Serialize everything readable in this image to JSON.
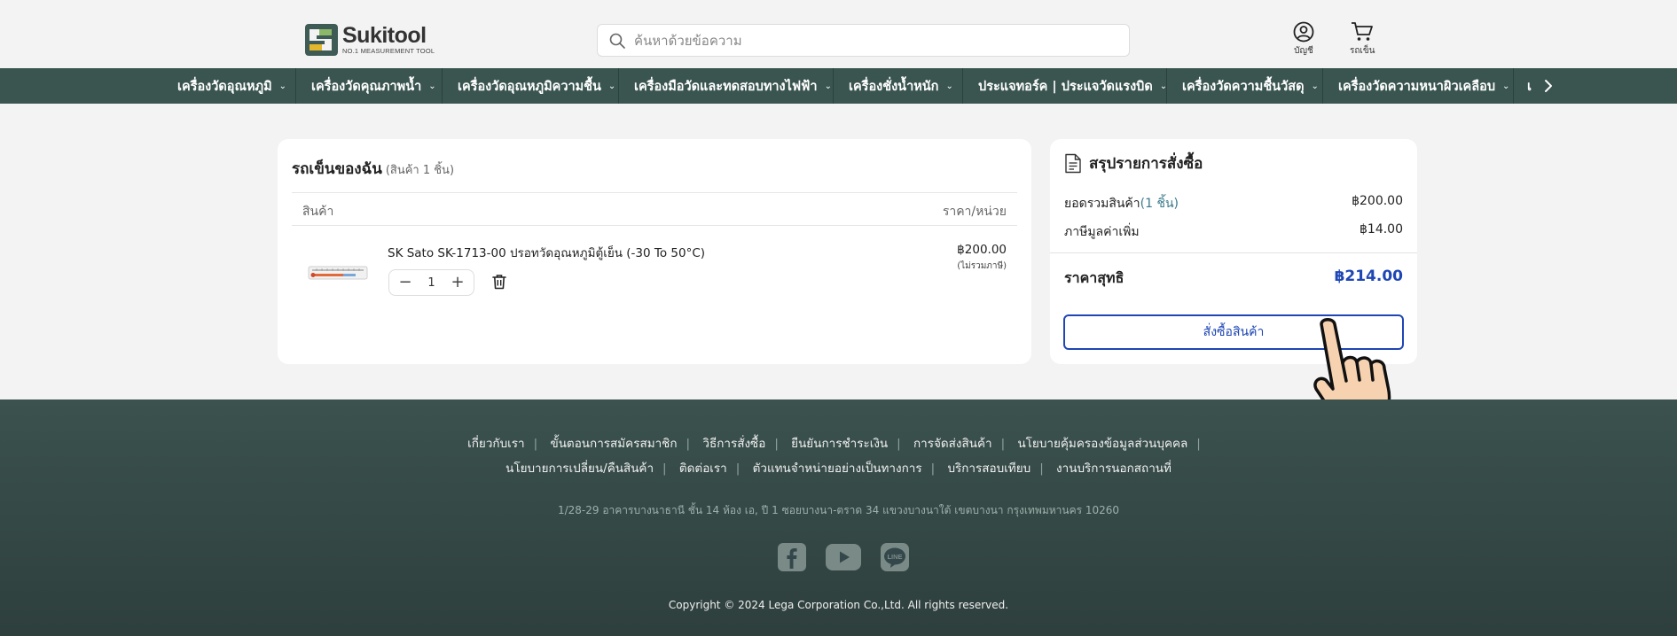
{
  "header": {
    "logo": {
      "name": "Sukitool",
      "tagline": "NO.1 MEASUREMENT TOOL"
    },
    "search": {
      "placeholder": "ค้นหาด้วยข้อความ"
    },
    "account_label": "บัญชี",
    "cart_label": "รถเข็น"
  },
  "nav": {
    "items": [
      "เครื่องวัดอุณหภูมิ",
      "เครื่องวัดคุณภาพน้ำ",
      "เครื่องวัดอุณหภูมิความชื้น",
      "เครื่องมือวัดและทดสอบทางไฟฟ้า",
      "เครื่องชั่งน้ำหนัก",
      "ประแจทอร์ค | ประแจวัดแรงบิด",
      "เครื่องวัดความชื้นวัสดุ",
      "เครื่องวัดความหนาผิวเคลือบ"
    ],
    "partial": "เ"
  },
  "cart": {
    "title": "รถเข็นของฉัน",
    "count_label": "(สินค้า 1 ชิ้น)",
    "col_product": "สินค้า",
    "col_price": "ราคา/หน่วย",
    "item": {
      "name": "SK Sato SK-1713-00 ปรอทวัดอุณหภูมิตู้เย็น (-30 To 50°C)",
      "quantity": "1",
      "price": "฿200.00",
      "price_note": "(ไม่รวมภาษี)"
    }
  },
  "summary": {
    "title": "สรุปรายการสั่งซื้อ",
    "subtotal_label": "ยอดรวมสินค้า",
    "subtotal_count": "(1 ชิ้น)",
    "subtotal": "฿200.00",
    "vat_label": "ภาษีมูลค่าเพิ่ม",
    "vat": "฿14.00",
    "total_label": "ราคาสุทธิ",
    "total": "฿214.00",
    "order_button": "สั่งซื้อสินค้า"
  },
  "footer": {
    "links_row1": [
      "เกี่ยวกับเรา",
      "ขั้นตอนการสมัครสมาชิก",
      "วิธีการสั่งซื้อ",
      "ยืนยันการชำระเงิน",
      "การจัดส่งสินค้า",
      "นโยบายคุ้มครองข้อมูลส่วนบุคคล"
    ],
    "links_row2": [
      "นโยบายการเปลี่ยน/คืนสินค้า",
      "ติดต่อเรา",
      "ตัวแทนจำหน่ายอย่างเป็นทางการ",
      "บริการสอบเทียบ",
      "งานบริการนอกสถานที่"
    ],
    "address": "1/28-29 อาคารบางนาธานี ชั้น 14 ห้อง เอ, ปี 1 ซอยบางนา-ตราด 34 แขวงบางนาใต้ เขตบางนา กรุงเทพมหานคร 10260",
    "socials": [
      "facebook-icon",
      "youtube-icon",
      "line-icon"
    ],
    "copyright": "Copyright © 2024 Lega Corporation Co.,Ltd. All rights reserved."
  },
  "colors": {
    "nav_bg": "#3a5550",
    "accent_blue": "#1e46b4",
    "footer_bg": "#33474440"
  }
}
